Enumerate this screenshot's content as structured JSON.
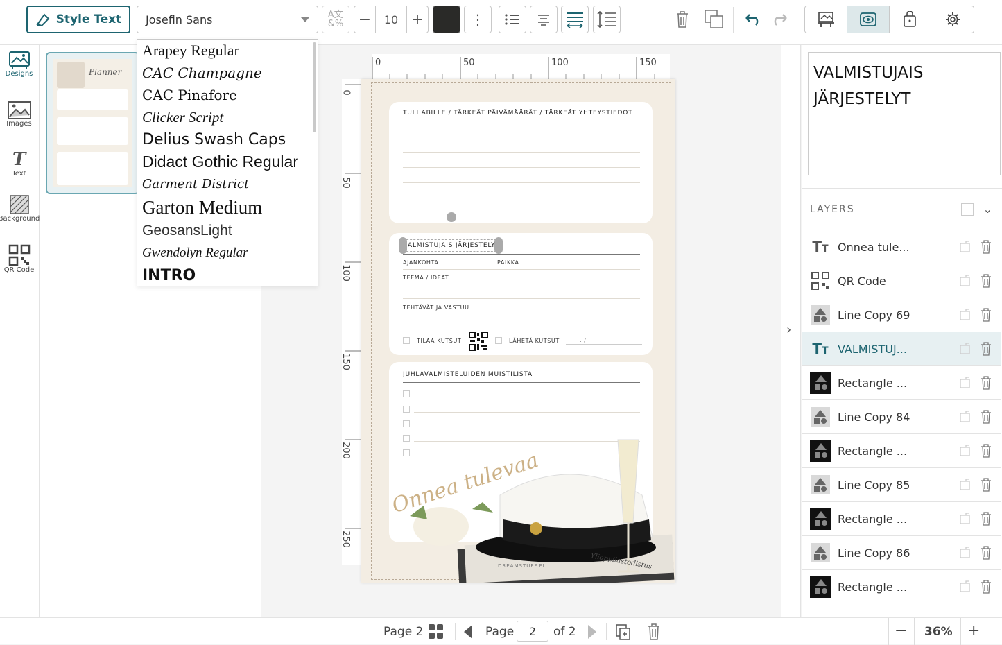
{
  "toolbar": {
    "style_text_label": "Style Text",
    "font_value": "Josefin Sans",
    "font_size": "10",
    "text_color": "#2a2a28"
  },
  "font_dropdown": {
    "options": [
      "Arapey Regular",
      "CAC Champagne",
      "CAC Pinafore",
      "Clicker Script",
      "Delius Swash Caps",
      "Didact Gothic Regular",
      "Garment District",
      "Garton Medium",
      "GeosansLight",
      "Gwendolyn Regular",
      "INTRO"
    ]
  },
  "leftbar": {
    "items": [
      {
        "label": "Designs",
        "icon": "designs-icon"
      },
      {
        "label": "Images",
        "icon": "images-icon"
      },
      {
        "label": "Text",
        "icon": "text-icon"
      },
      {
        "label": "Background",
        "icon": "background-icon"
      },
      {
        "label": "QR Code",
        "icon": "qr-code-icon"
      }
    ]
  },
  "thumbnail": {
    "title": "Planner"
  },
  "ruler": {
    "top_labels": [
      "0",
      "50",
      "100",
      "150"
    ],
    "left_labels": [
      "0",
      "50",
      "100",
      "150",
      "200",
      "250"
    ]
  },
  "page": {
    "card1_title": "TULI ABILLE / TÄRKEÄT PÄIVÄMÄÄRÄT / TÄRKEÄT YHTEYSTIEDOT",
    "card2_title": "ALMISTUJAIS JÄRJESTELY",
    "card2_labels": {
      "ajankohta": "AJANKOHTA",
      "paikka": "PAIKKA",
      "teema": "TEEMA / IDEAT",
      "tehtavat": "TEHTÄVÄT JA VASTUU",
      "tilaa": "TILAA KUTSUT",
      "laheta": "LÄHETÄ KUTSUT",
      "date": ". /"
    },
    "card3_title": "JUHLAVALMISTELUIDEN MUISTILISTA",
    "script_text": "Onnea tulevaa",
    "footer_brand": "DREAMSTUFF.FI",
    "certificate": "Ylioppilastodistus"
  },
  "rightpanel": {
    "text_content_line1": "VALMISTUJAIS",
    "text_content_line2": "JÄRJESTELYT",
    "layers_title": "LAYERS",
    "layers": [
      {
        "label": "Onnea tule...",
        "type": "text"
      },
      {
        "label": "QR Code",
        "type": "qr"
      },
      {
        "label": "Line Copy 69",
        "type": "shape"
      },
      {
        "label": "VALMISTUJ...",
        "type": "text",
        "selected": true
      },
      {
        "label": "Rectangle ...",
        "type": "rect"
      },
      {
        "label": "Line Copy 84",
        "type": "shape"
      },
      {
        "label": "Rectangle ...",
        "type": "rect"
      },
      {
        "label": "Line Copy 85",
        "type": "shape"
      },
      {
        "label": "Rectangle ...",
        "type": "rect"
      },
      {
        "label": "Line Copy 86",
        "type": "shape"
      },
      {
        "label": "Rectangle ...",
        "type": "rect"
      }
    ]
  },
  "bottombar": {
    "page_label": "Page 2",
    "page_word": "Page",
    "page_current": "2",
    "page_total": "of 2",
    "zoom": "36%"
  }
}
